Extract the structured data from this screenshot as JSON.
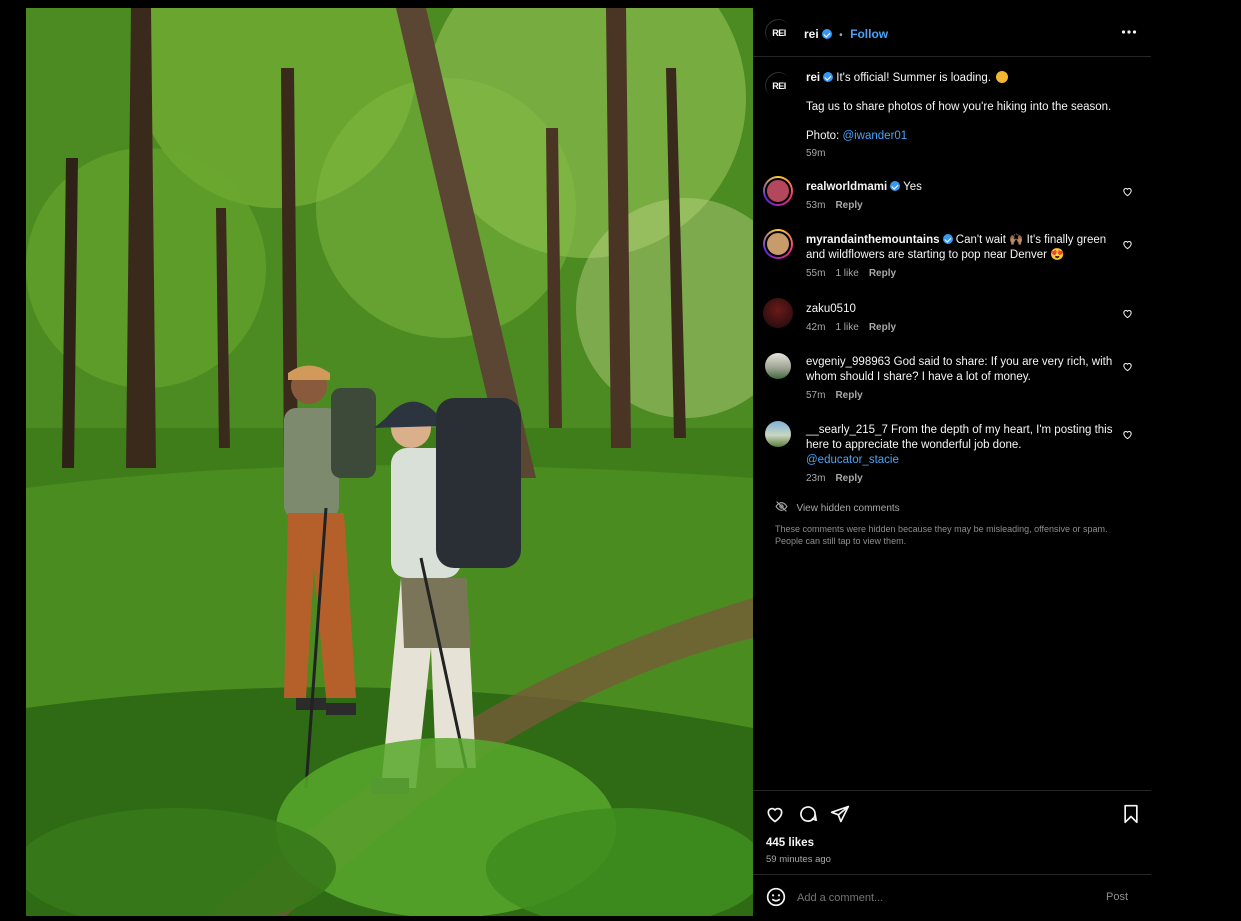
{
  "post": {
    "username": "rei",
    "follow_label": "Follow",
    "separator": "•",
    "caption_line1": "It's official! Summer is loading.",
    "caption_line2": "Tag us to share photos of how you're hiking into the season.",
    "photo_prefix": "Photo:",
    "photo_credit": "@iwander01",
    "time": "59m"
  },
  "comments": [
    {
      "user": "realworldmami",
      "verified": true,
      "text": "Yes",
      "time": "53m",
      "likes": "",
      "reply": "Reply"
    },
    {
      "user": "myrandainthemountains",
      "verified": true,
      "text": "Can't wait 🙌🏽 It's finally green and wildflowers are starting to pop near Denver 😍",
      "time": "55m",
      "likes": "1 like",
      "reply": "Reply"
    },
    {
      "user": "zaku0510",
      "verified": false,
      "text": "",
      "time": "42m",
      "likes": "1 like",
      "reply": "Reply"
    },
    {
      "user": "evgeniy_998963",
      "verified": false,
      "text": "God said to share: If you are very rich, with whom should I share? I have a lot of money.",
      "time": "57m",
      "likes": "",
      "reply": "Reply"
    },
    {
      "user": "__searly_215_7",
      "verified": false,
      "text": "From the depth of my heart, I'm posting this here to appreciate the wonderful job done.",
      "mention": "@educator_stacie",
      "time": "23m",
      "likes": "",
      "reply": "Reply"
    }
  ],
  "hidden": {
    "label": "View hidden comments",
    "note": "These comments were hidden because they may be misleading, offensive or spam. People can still tap to view them."
  },
  "stats": {
    "likes": "445 likes",
    "posted": "59 minutes ago"
  },
  "composer": {
    "placeholder": "Add a comment...",
    "post_label": "Post"
  },
  "colors": {
    "accent": "#4aa3f5",
    "verified": "#3897f0",
    "background": "#000000",
    "divider": "#262626"
  },
  "icons": [
    "more-options-icon",
    "heart-icon",
    "comment-icon",
    "share-icon",
    "bookmark-icon",
    "emoji-icon",
    "hidden-eye-icon"
  ]
}
